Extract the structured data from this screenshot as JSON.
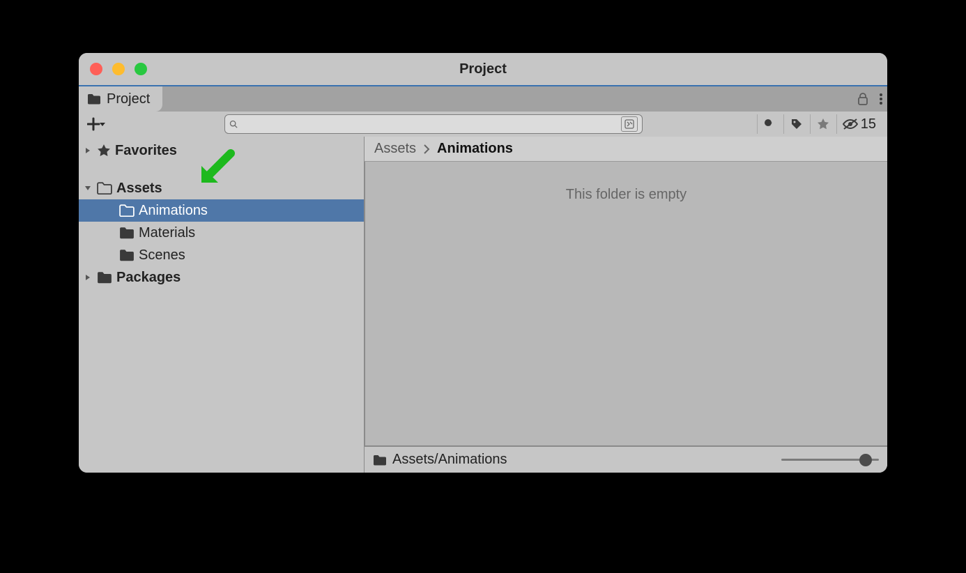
{
  "window": {
    "title": "Project"
  },
  "tab": {
    "label": "Project"
  },
  "toolbar": {
    "search_placeholder": "",
    "hidden_count": "15"
  },
  "sidebar": {
    "favorites_label": "Favorites",
    "assets_label": "Assets",
    "packages_label": "Packages",
    "assets_children": [
      {
        "label": "Animations",
        "selected": true
      },
      {
        "label": "Materials",
        "selected": false
      },
      {
        "label": "Scenes",
        "selected": false
      }
    ]
  },
  "breadcrumb": {
    "root": "Assets",
    "current": "Animations"
  },
  "content": {
    "empty_message": "This folder is empty",
    "footer_path": "Assets/Animations"
  }
}
